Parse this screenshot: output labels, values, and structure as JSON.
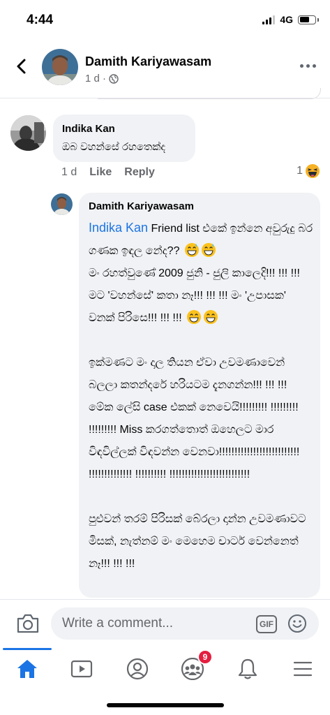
{
  "status_bar": {
    "time": "4:44",
    "network": "4G"
  },
  "header": {
    "name": "Damith Kariyawasam",
    "meta": "1 d ·"
  },
  "comment": {
    "author": "Indika Kan",
    "text": "ඔබ වහන්සේ රහතෙක්ද",
    "time": "1 d",
    "like_label": "Like",
    "reply_label": "Reply",
    "reaction_count": "1"
  },
  "reply": {
    "author": "Damith Kariyawasam",
    "mention": "Indika Kan",
    "para1": " Friend list එකේ ඉන්නෙ අවුරුදු බර ගණක ඉඳල නේද?? ",
    "para2": "මං රහත්වුණේ 2009 ජුනි - ජුලි කාලෙදි!!! !!! !!! මට 'වහන්සේ' කතා නෑ!!! !!! !!! මං 'උපාසක' වනක් පිරිසෙ!!! !!! !!! ",
    "para3": "ඉක්මණට මං දාල තියන ඒවා උවමණාවෙන් බලලා කතන්දරේ හරියටම දැනගන්න!!! !!! !!! මේක ලේසි case එකක් නෙවෙයි!!!!!!!!! !!!!!!!!! !!!!!!!!! Miss කරගත්තොත් ඔහෙලට මාර විඳවිල්ලක් විඳවන්න වෙනවා!!!!!!!!!!!!!!!!!!!!!!!!!! !!!!!!!!!!!!!! !!!!!!!!!! !!!!!!!!!!!!!!!!!!!!!!!!!!",
    "para4": "පුළුවන් තරම් පිරිසක් බේරලා දාන්න උවමණාවට මිසක්, නැත්නම් මං මෙහෙම චාටර් වෙන්නෙත් නෑ!!! !!! !!!"
  },
  "composer": {
    "placeholder": "Write a comment...",
    "gif_label": "GIF"
  },
  "nav": {
    "groups_badge": "9"
  },
  "icons": [
    "back-icon",
    "globe-icon",
    "more-icon",
    "haha-icon",
    "grin-sweat-icon",
    "grin-icon",
    "camera-icon",
    "gif-icon",
    "smiley-icon",
    "home-icon",
    "video-icon",
    "profile-icon",
    "groups-icon",
    "bell-icon",
    "menu-icon"
  ],
  "colors": {
    "link": "#1b74e4",
    "bubble": "#f0f2f5",
    "secondary_text": "#65676b",
    "badge": "#e41e3f"
  }
}
